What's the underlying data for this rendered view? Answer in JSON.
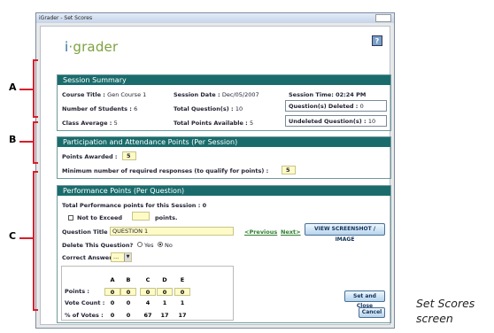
{
  "window": {
    "title": "iGrader - Set Scores"
  },
  "logo": {
    "i": "i",
    "rest": "grader"
  },
  "help_label": "?",
  "callouts": [
    "A",
    "B",
    "C"
  ],
  "caption": [
    "Set Scores",
    "screen"
  ],
  "summary": {
    "header": "Session Summary",
    "course_title_label": "Course Title :",
    "course_title": "Gen Course 1",
    "session_date_label": "Session Date :",
    "session_date": "Dec/05/2007",
    "session_time_label": "Session Time:",
    "session_time": "02:24 PM",
    "students_label": "Number of Students :",
    "students": "6",
    "total_q_label": "Total Question(s) :",
    "total_q": "10",
    "deleted_label": "Question(s) Deleted :",
    "deleted": "0",
    "avg_label": "Class Average :",
    "avg": "5",
    "points_avail_label": "Total Points Available :",
    "points_avail": "5",
    "undeleted_label": "Undeleted Question(s) :",
    "undeleted": "10"
  },
  "participation": {
    "header": "Participation and Attendance Points (Per Session)",
    "awarded_label": "Points Awarded :",
    "awarded": "5",
    "min_label": "Minimum number of required responses (to qualify for points) :",
    "min": "5"
  },
  "performance": {
    "header": "Performance Points (Per Question)",
    "total_label": "Total Performance points for this Session :",
    "total": "0",
    "not_exceed": "Not to Exceed",
    "points_word": "points.",
    "qtitle_label": "Question Title :",
    "qtitle": "QUESTION 1",
    "previous": "<Previous",
    "next": "Next>",
    "screenshot_btn": "VIEW SCREENSHOT / IMAGE",
    "delete_label": "Delete This Question?",
    "yes": "Yes",
    "no": "No",
    "correct_label": "Correct Answer :",
    "correct_value": "...",
    "grid": {
      "cols": [
        "A",
        "B",
        "C",
        "D",
        "E"
      ],
      "points_label": "Points :",
      "points": [
        "0",
        "0",
        "0",
        "0",
        "0"
      ],
      "vote_label": "Vote Count :",
      "votes": [
        "0",
        "0",
        "4",
        "1",
        "1"
      ],
      "pct_label": "% of Votes :",
      "pct": [
        "0",
        "0",
        "67",
        "17",
        "17"
      ]
    },
    "set_close": "Set and Close",
    "cancel": "Cancel"
  }
}
